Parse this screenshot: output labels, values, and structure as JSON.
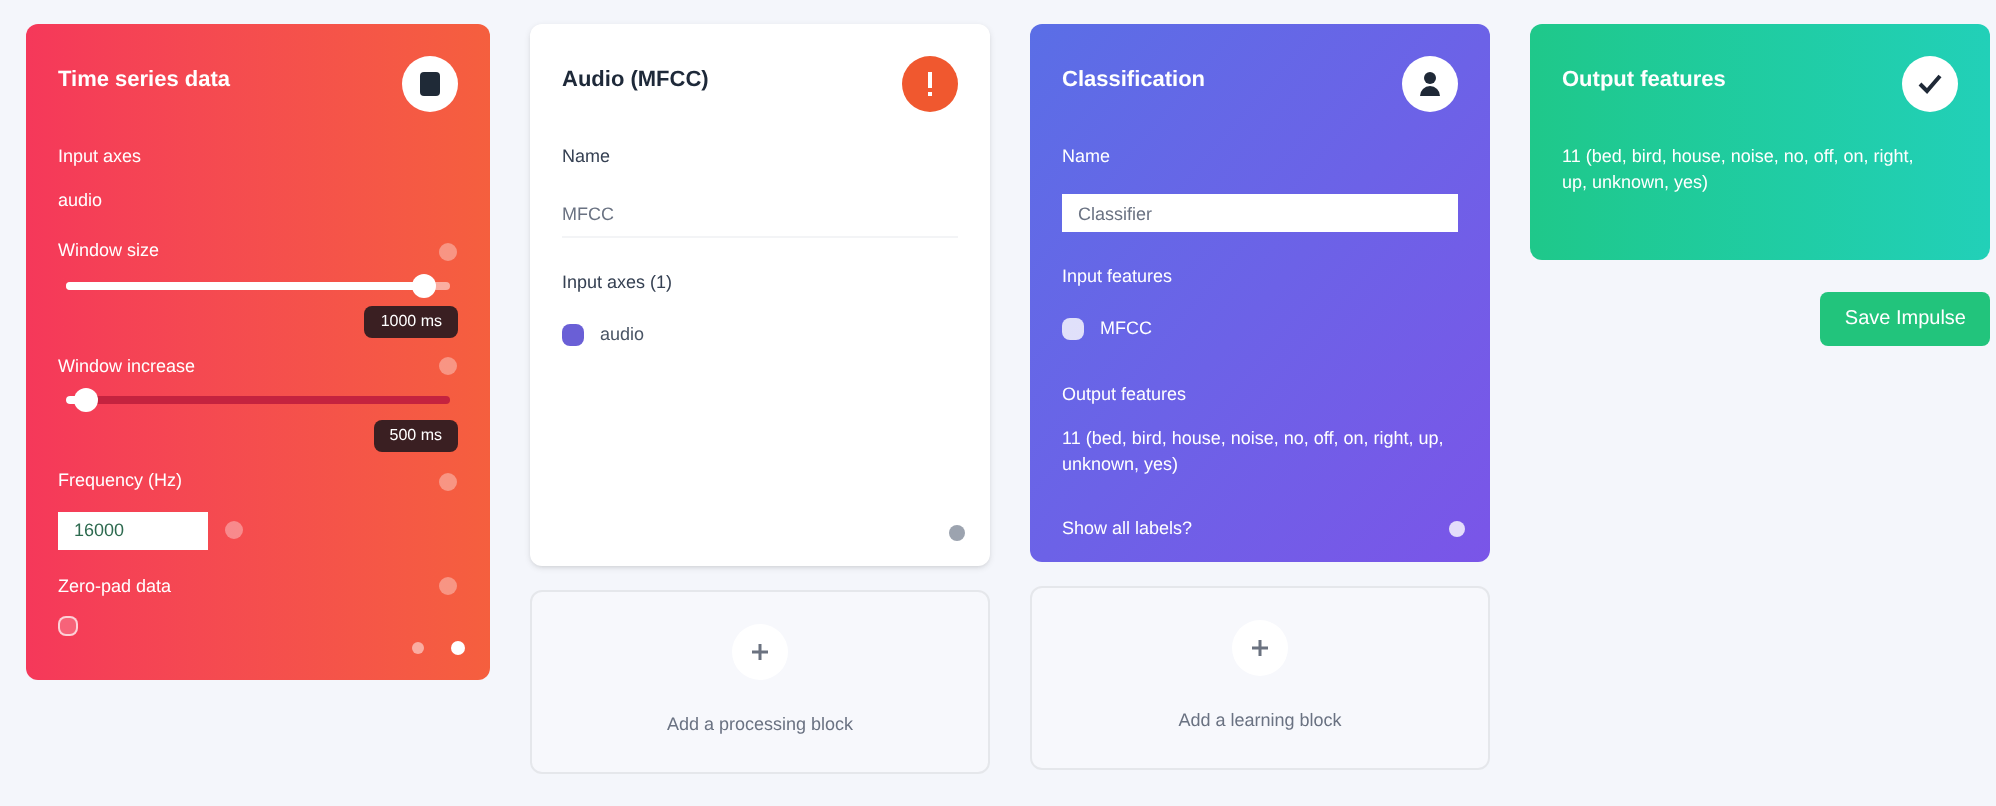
{
  "input_block": {
    "title": "Time series data",
    "fields": [
      {
        "kind": "text",
        "label": "Input axes",
        "value": "audio"
      },
      {
        "kind": "slider",
        "label": "Window size",
        "level": 0.93,
        "reading": "1000 ms"
      },
      {
        "kind": "slider",
        "label": "Window increase",
        "level": 0.05,
        "reading": "500 ms"
      },
      {
        "kind": "input",
        "label": "Frequency (Hz)",
        "value": "16000"
      },
      {
        "kind": "checkbox",
        "label": "Zero-pad data",
        "checked": false
      }
    ]
  },
  "processing_block": {
    "title": "Audio (MFCC)",
    "name_label": "Name",
    "name_value": "MFCC",
    "axes_label": "Input axes (1)",
    "axes": [
      {
        "label": "audio",
        "checked": true
      }
    ]
  },
  "add_processing": {
    "label": "Add a processing block"
  },
  "learning_block": {
    "title": "Classification",
    "name_label": "Name",
    "name_value": "Classifier",
    "features_label": "Input features",
    "features": [
      {
        "label": "MFCC",
        "checked": true
      }
    ],
    "output_label": "Output features",
    "output_value": "11 (bed, bird, house, noise, no, off, on, right, up, unknown, yes)",
    "link": "Show all labels?"
  },
  "add_learning": {
    "label": "Add a learning block"
  },
  "output_block": {
    "title": "Output features",
    "text": "11 (bed, bird, house, noise, no, off, on, right, up, unknown, yes)"
  },
  "save_button": "Save Impulse"
}
